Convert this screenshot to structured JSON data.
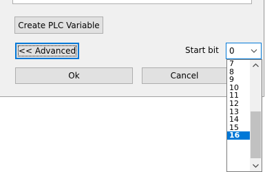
{
  "dialog": {
    "create_plc_variable_label": "Create PLC Variable",
    "advanced_label": "<< Advanced",
    "start_bit_label": "Start bit",
    "start_bit_value": "0",
    "ok_label": "Ok",
    "cancel_label": "Cancel"
  },
  "dropdown": {
    "options": [
      "7",
      "8",
      "9",
      "10",
      "11",
      "12",
      "13",
      "14",
      "15",
      "16"
    ],
    "selected": "16"
  },
  "icons": {
    "combo_arrow": "chevron-down-icon",
    "scroll_up": "chevron-up-icon",
    "scroll_down": "chevron-down-icon"
  },
  "colors": {
    "accent": "#0078d7",
    "button_face": "#e1e1e1",
    "dialog_background": "#f0f0f0",
    "scroll_thumb": "#c1c1c1"
  }
}
